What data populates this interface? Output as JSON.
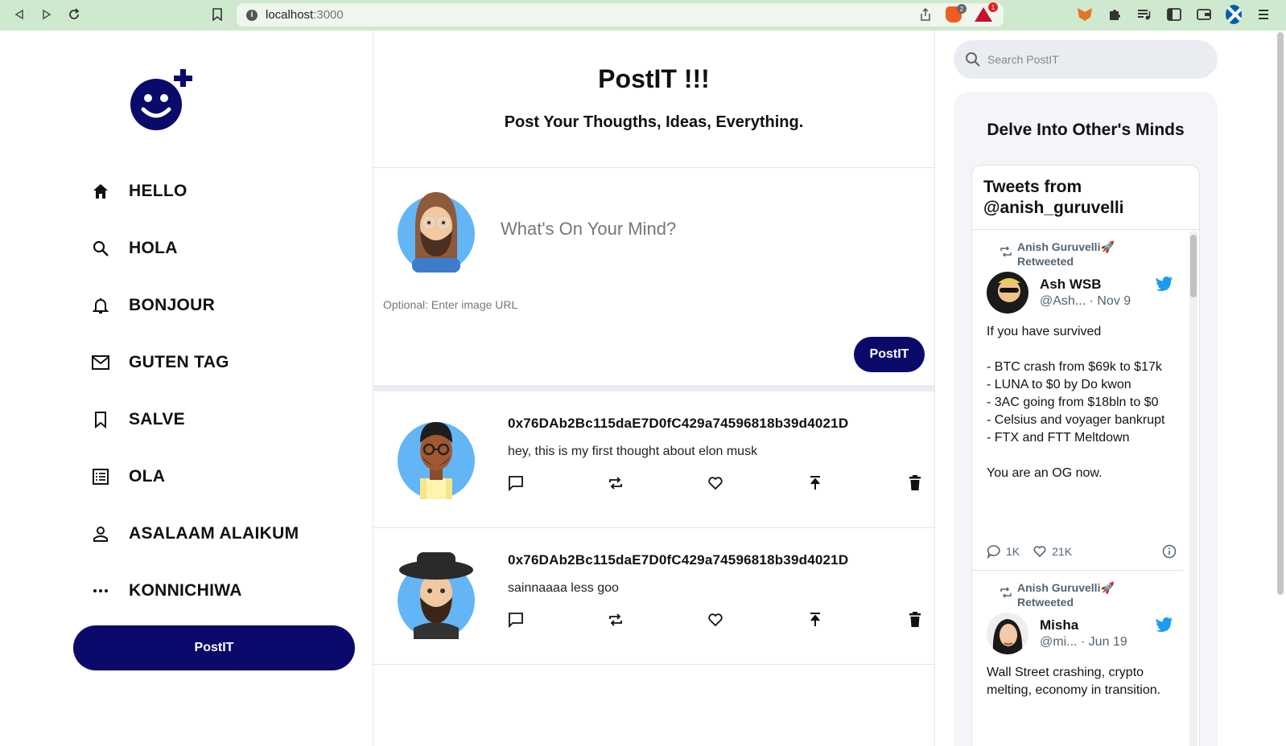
{
  "browser": {
    "url_host": "localhost",
    "url_port": ":3000",
    "brave_badge": "2",
    "rewards_badge": "1"
  },
  "sidebar": {
    "items": [
      {
        "label": "HELLO",
        "icon": "home-icon"
      },
      {
        "label": "HOLA",
        "icon": "search-icon"
      },
      {
        "label": "BONJOUR",
        "icon": "bell-icon"
      },
      {
        "label": "GUTEN TAG",
        "icon": "mail-icon"
      },
      {
        "label": "SALVE",
        "icon": "bookmark-icon"
      },
      {
        "label": "OLA",
        "icon": "list-icon"
      },
      {
        "label": "ASALAAM ALAIKUM",
        "icon": "person-icon"
      },
      {
        "label": "KONNICHIWA",
        "icon": "more-icon"
      }
    ],
    "post_button": "PostIT"
  },
  "feed": {
    "title": "PostIT !!!",
    "subtitle": "Post Your Thougths, Ideas, Everything.",
    "composer": {
      "placeholder": "What's On Your Mind?",
      "image_placeholder": "Optional: Enter image URL",
      "button": "PostIT"
    },
    "posts": [
      {
        "author": "0x76DAb2Bc115daE7D0fC429a74596818b39d4021D",
        "text": "hey, this is my first thought about elon musk"
      },
      {
        "author": "0x76DAb2Bc115daE7D0fC429a74596818b39d4021D",
        "text": "sainnaaaa less goo"
      }
    ]
  },
  "right": {
    "search_placeholder": "Search PostIT",
    "widget_title": "Delve Into Other's Minds",
    "timeline_title": "Tweets from @anish_guruvelli",
    "tweets": [
      {
        "retweeted_by": "Anish Guruvelli🚀 Retweeted",
        "name": "Ash WSB",
        "handle": "@Ash... · Nov 9",
        "text": "If you have survived\n\n- BTC crash from $69k to $17k\n- LUNA to $0 by Do kwon\n- 3AC going from $18bln to $0\n- Celsius and voyager bankrupt\n- FTX and FTT Meltdown\n\nYou are an OG now.",
        "replies": "1K",
        "likes": "21K"
      },
      {
        "retweeted_by": "Anish Guruvelli🚀 Retweeted",
        "name": "Misha",
        "handle": "@mi...  · Jun 19",
        "text": "Wall Street crashing, crypto melting, economy in transition."
      }
    ]
  },
  "colors": {
    "brand_navy": "#0a0a6b",
    "chrome_green": "#cfe9cf",
    "twitter_blue": "#1d9bf0"
  }
}
